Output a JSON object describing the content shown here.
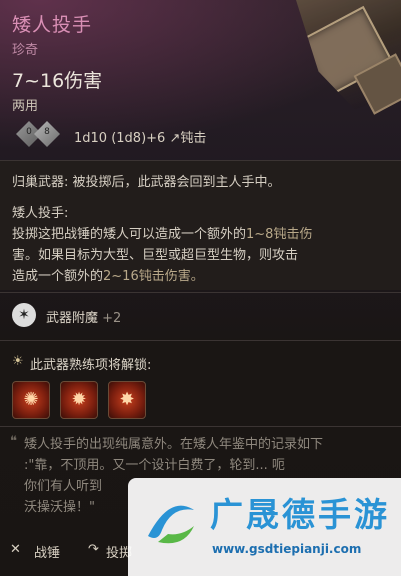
{
  "item": {
    "name": "矮人投手",
    "rarity": "珍奇",
    "damage_range": "7~16伤害",
    "handedness": "两用",
    "dice": [
      "0",
      "8"
    ],
    "damage_formula": "1d10 (1d8)+6",
    "damage_type": "钝击"
  },
  "properties": {
    "returning_label": "归巢武器:",
    "returning_text": "被投掷后，此武器会回到主人手中。",
    "ability_title": "矮人投手:",
    "ability_text_1": "投掷这把战锤的矮人可以造成一个额外的",
    "ability_hl_1": "1~8钝击伤",
    "ability_text_2": "害。如果目标为大型、巨型或超巨型生物，则攻击",
    "ability_text_3": "造成一个额外的",
    "ability_hl_2": "2~16钝击伤害。"
  },
  "enchant": {
    "label": "武器附魔",
    "value": "+2"
  },
  "proficiency": {
    "label": "此武器熟练项将解锁:",
    "skills": [
      "skill-1",
      "skill-2",
      "skill-3"
    ]
  },
  "flavor": {
    "line1": "矮人投手的出现纯属意外。在矮人年鉴中的记录如下",
    "line2": ":\"靠，不顶用。又一个设计白费了，轮到... 呃",
    "line3": "你们有人听到",
    "line4": "沃操沃操！\""
  },
  "footer": {
    "type_label": "战锤",
    "throw_label": "投掷"
  },
  "watermark": {
    "title": "广晟德手游",
    "url": "www.gsdtiepianji.com"
  },
  "colors": {
    "name": "#d98fb5",
    "accent": "#b9a98a",
    "watermark": "#2a93d5"
  }
}
